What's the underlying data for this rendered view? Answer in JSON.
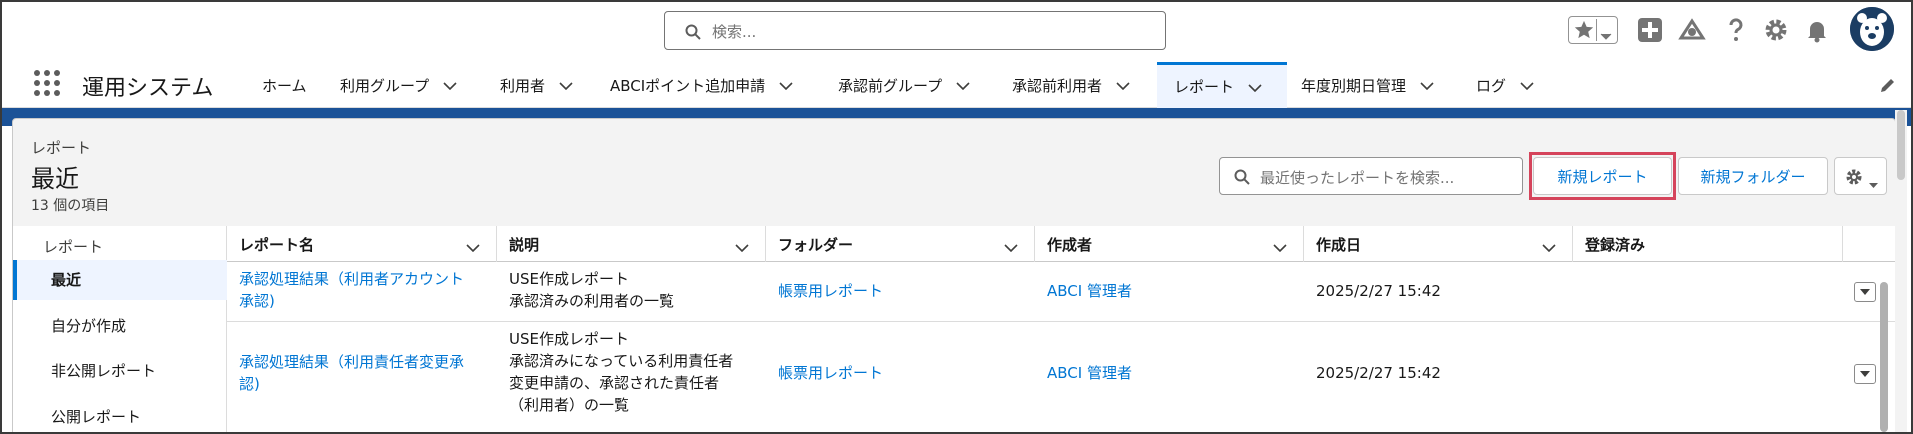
{
  "search": {
    "placeholder": "検索..."
  },
  "header_icons": [
    "favorites-star-icon",
    "add-icon",
    "trailhead-icon",
    "help-icon",
    "setup-gear-icon",
    "notifications-bell-icon",
    "user-avatar"
  ],
  "app": {
    "name": "運用システム"
  },
  "nav": {
    "items": [
      {
        "label": "ホーム",
        "has_dropdown": false
      },
      {
        "label": "利用グループ",
        "has_dropdown": true
      },
      {
        "label": "利用者",
        "has_dropdown": true
      },
      {
        "label": "ABCIポイント追加申請",
        "has_dropdown": true
      },
      {
        "label": "承認前グループ",
        "has_dropdown": true
      },
      {
        "label": "承認前利用者",
        "has_dropdown": true
      },
      {
        "label": "レポート",
        "has_dropdown": true,
        "active": true
      },
      {
        "label": "年度別期日管理",
        "has_dropdown": true
      },
      {
        "label": "ログ",
        "has_dropdown": true
      }
    ]
  },
  "page": {
    "breadcrumb": "レポート",
    "title": "最近",
    "item_count": "13 個の項目",
    "search_placeholder": "最近使ったレポートを検索...",
    "new_report": "新規レポート",
    "new_folder": "新規フォルダー"
  },
  "sidebar": {
    "header": "レポート",
    "items": [
      {
        "label": "最近",
        "selected": true
      },
      {
        "label": "自分が作成"
      },
      {
        "label": "非公開レポート"
      },
      {
        "label": "公開レポート"
      }
    ]
  },
  "table": {
    "columns": [
      "レポート名",
      "説明",
      "フォルダー",
      "作成者",
      "作成日",
      "登録済み"
    ],
    "rows": [
      {
        "name": [
          "承認処理結果（利用者アカウント",
          "承認)"
        ],
        "description": [
          "USE作成レポート",
          "承認済みの利用者の一覧"
        ],
        "folder": "帳票用レポート",
        "created_by": "ABCI 管理者",
        "created_date": "2025/2/27 15:42"
      },
      {
        "name": [
          "承認処理結果（利用責任者変更承",
          "認)"
        ],
        "description": [
          "USE作成レポート",
          "承認済みになっている利用責任者",
          "変更申請の、承認された責任者",
          "（利用者）の一覧"
        ],
        "folder": "帳票用レポート",
        "created_by": "ABCI 管理者",
        "created_date": "2025/2/27 15:42"
      }
    ]
  },
  "colors": {
    "accent": "#0176d3",
    "band": "#1b5297",
    "highlight": "#d5445b"
  }
}
